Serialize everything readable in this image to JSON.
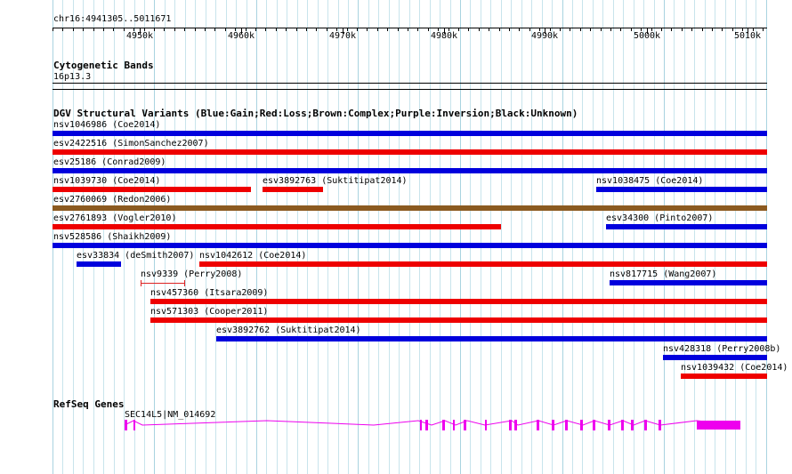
{
  "ruler": {
    "position": "chr16:4941305..5011671",
    "ticks": [
      "4950k",
      "4960k",
      "4970k",
      "4980k",
      "4990k",
      "5000k",
      "5010k"
    ]
  },
  "cytoband": {
    "title": "Cytogenetic Bands",
    "band": "16p13.3"
  },
  "dgv": {
    "title": "DGV Structural Variants (Blue:Gain;Red:Loss;Brown:Complex;Purple:Inversion;Black:Unknown)",
    "colors": {
      "gain": "#0000dd",
      "loss": "#ee0000",
      "complex": "#8b5a20",
      "small_loss": "#dd2222"
    },
    "variants": [
      {
        "label": "nsv1046986 (Coe2014)",
        "type": "gain"
      },
      {
        "label": "esv2422516 (SimonSanchez2007)",
        "type": "loss"
      },
      {
        "label": "esv25186 (Conrad2009)",
        "type": "gain"
      },
      {
        "label": "nsv1039730 (Coe2014)",
        "type": "loss"
      },
      {
        "label": "esv3892763 (Suktitipat2014)",
        "type": "loss"
      },
      {
        "label": "nsv1038475 (Coe2014)",
        "type": "gain"
      },
      {
        "label": "esv2760069 (Redon2006)",
        "type": "complex"
      },
      {
        "label": "esv2761893 (Vogler2010)",
        "type": "loss"
      },
      {
        "label": "esv34300 (Pinto2007)",
        "type": "gain"
      },
      {
        "label": "nsv528586 (Shaikh2009)",
        "type": "gain"
      },
      {
        "label": "esv33834 (deSmith2007)",
        "type": "gain"
      },
      {
        "label": "nsv1042612 (Coe2014)",
        "type": "loss"
      },
      {
        "label": "nsv9339 (Perry2008)",
        "type": "loss"
      },
      {
        "label": "nsv817715 (Wang2007)",
        "type": "gain"
      },
      {
        "label": "nsv457360 (Itsara2009)",
        "type": "loss"
      },
      {
        "label": "nsv571303 (Cooper2011)",
        "type": "loss"
      },
      {
        "label": "esv3892762 (Suktitipat2014)",
        "type": "gain"
      },
      {
        "label": "nsv428318 (Perry2008b)",
        "type": "gain"
      },
      {
        "label": "nsv1039432 (Coe2014)",
        "type": "loss"
      }
    ]
  },
  "refseq": {
    "title": "RefSeq Genes",
    "gene_label": "SEC14L5|NM_014692",
    "color": "#ee00ee"
  }
}
